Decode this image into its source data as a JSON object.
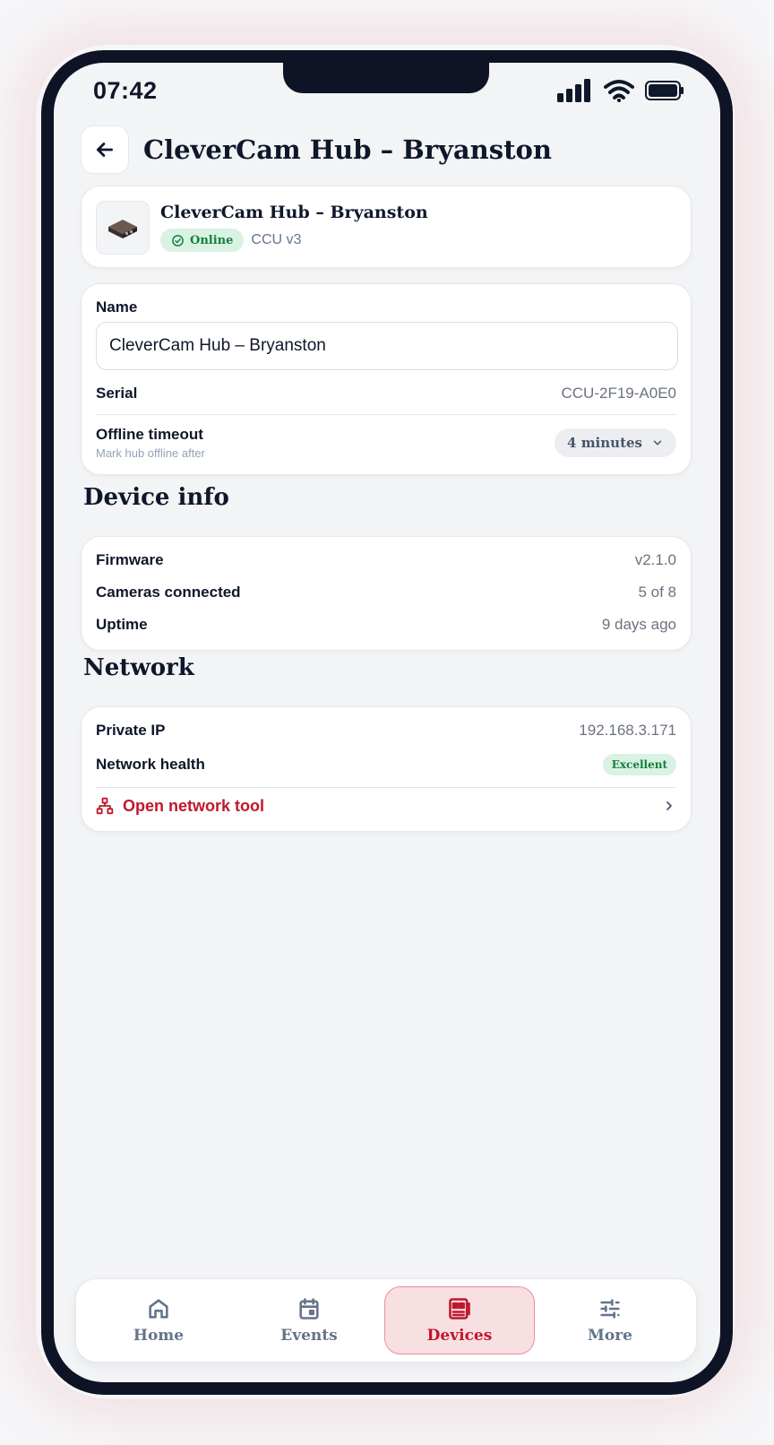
{
  "status_bar": {
    "time": "07:42"
  },
  "header": {
    "title": "CleverCam Hub – Bryanston"
  },
  "device": {
    "name": "CleverCam Hub – Bryanston",
    "status": "Online",
    "model": "CCU v3"
  },
  "settings": {
    "name_label": "Name",
    "name_value": "CleverCam Hub – Bryanston",
    "serial_label": "Serial",
    "serial_value": "CCU-2F19-A0E0",
    "timeout_label": "Offline timeout",
    "timeout_sublabel": "Mark hub offline after",
    "timeout_value": "4 minutes"
  },
  "device_info": {
    "title": "Device info",
    "rows": [
      {
        "label": "Firmware",
        "value": "v2.1.0"
      },
      {
        "label": "Cameras connected",
        "value": "5 of 8"
      },
      {
        "label": "Uptime",
        "value": "9 days ago"
      }
    ]
  },
  "network": {
    "title": "Network",
    "ip_label": "Private IP",
    "ip_value": "192.168.3.171",
    "health_label": "Network health",
    "health_value": "Excellent",
    "tool_label": "Open network tool"
  },
  "tabs": [
    {
      "label": "Home",
      "icon": "home-icon"
    },
    {
      "label": "Events",
      "icon": "calendar-icon"
    },
    {
      "label": "Devices",
      "icon": "devices-icon",
      "active": true
    },
    {
      "label": "More",
      "icon": "sliders-icon"
    }
  ],
  "colors": {
    "accent": "#c0172c",
    "success": "#15803d",
    "success_bg": "#d9f2e3",
    "frame": "#0e1325"
  }
}
